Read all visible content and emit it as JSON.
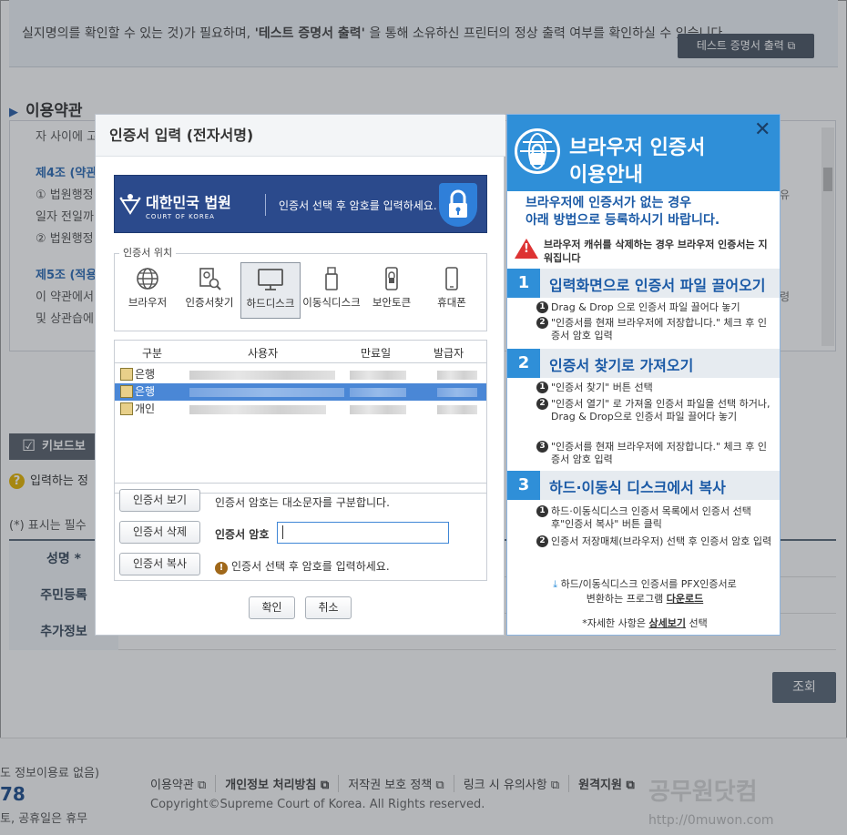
{
  "background": {
    "notice_line1": "실지명의를 확인할 수 있는 것)가 필요하며, ",
    "notice_bold": "'테스트 증명서 출력'",
    "notice_line1b": " 을 통해 소유하신 프린터의 정상 출력 여부를 확인하실 수 있습니다.",
    "test_print_button": "테스트 증명서 출력",
    "terms_title": "이용약관",
    "terms_lines": [
      "자 사이에 고",
      "제4조 (약관",
      "① 법원행정",
      "일자 전일까",
      "② 법원행정",
      "제5조 (적용",
      "이 약관에서",
      "및 상관습에"
    ],
    "terms_right_1": "유",
    "terms_right_2": "령",
    "keyboard_button": "키보드보",
    "help_text": "입력하는 정",
    "required_note": "(*) 표시는 필수",
    "form_labels": [
      "성명 *",
      "주민등록",
      "추가정보"
    ],
    "query_button": "조회",
    "footer_left1": "도 정보이용료 없음)",
    "footer_left2": "78",
    "footer_left3": "토, 공휴일은 휴무",
    "footer_links": [
      "이용약관",
      "개인정보 처리방침",
      "저작권 보호 정책",
      "링크 시 유의사항",
      "원격지원"
    ],
    "copyright": "Copyright©Supreme Court of Korea. All Rights reserved.",
    "watermark": "공무원닷컴",
    "watermark_url": "http://0muwon.com"
  },
  "dialog": {
    "title": "인증서 입력 (전자서명)",
    "banner_name": "대한민국 법원",
    "banner_sub": "COURT OF KOREA",
    "banner_msg": "인증서 선택 후 암호를 입력하세요.",
    "location_legend": "인증서 위치",
    "locations": [
      {
        "label": "브라우저",
        "icon": "globe-icon"
      },
      {
        "label": "인증서찾기",
        "icon": "cert-search-icon"
      },
      {
        "label": "하드디스크",
        "icon": "monitor-icon"
      },
      {
        "label": "이동식디스크",
        "icon": "usb-icon"
      },
      {
        "label": "보안토큰",
        "icon": "token-icon"
      },
      {
        "label": "휴대폰",
        "icon": "phone-icon"
      }
    ],
    "selected_location": "하드디스크",
    "table_headers": [
      "구분",
      "사용자",
      "만료일",
      "발급자"
    ],
    "rows": [
      {
        "type": "은행"
      },
      {
        "type": "은행"
      },
      {
        "type": "개인"
      }
    ],
    "view_button": "인증서 보기",
    "delete_button": "인증서 삭제",
    "copy_button": "인증서 복사",
    "case_note": "인증서 암호는 대소문자를 구분합니다.",
    "password_label": "인증서 암호",
    "password_value": "",
    "warning_msg": "인증서 선택 후 암호를 입력하세요.",
    "ok_button": "확인",
    "cancel_button": "취소"
  },
  "guide": {
    "title1": "브라우저 인증서",
    "title2": "이용안내",
    "intro1": "브라우저에 인증서가 없는 경우",
    "intro2": "아래 방법으로 등록하시기 바랍니다.",
    "warning": "브라우저 캐쉬를 삭제하는 경우 브라우저 인증서는 지워집니다",
    "sections": [
      {
        "num": "1",
        "title": "입력화면으로 인증서 파일 끌어오기"
      },
      {
        "num": "2",
        "title": "인증서 찾기로 가져오기"
      },
      {
        "num": "3",
        "title": "하드·이동식 디스크에서 복사"
      }
    ],
    "s1_steps": [
      "Drag & Drop 으로 인증서 파일 끌어다 놓기",
      "\"인증서를 현재 브라우저에 저장합니다.\" 체크 후 인증서 암호 입력"
    ],
    "s2_steps": [
      "\"인증서 찾기\" 버튼 선택",
      "\"인증서 열기\" 로 가져올 인증서 파일을 선택 하거나, Drag & Drop으로 인증서 파일 끌어다 놓기",
      "\"인증서를 현재 브라우저에 저장합니다.\" 체크 후 인증서 암호 입력"
    ],
    "s3_steps": [
      "하드·이동식디스크 인증서 목록에서 인증서 선택 후\"인증서 복사\" 버튼 클릭",
      "인증서 저장매체(브라우저) 선택 후 인증서 암호 입력"
    ],
    "pfx_line1": "하드/이동식디스크 인증서를 PFX인증서로",
    "pfx_line2": "변환하는 프로그램",
    "pfx_link": "다운로드",
    "detail_pre": "*자세한 사항은",
    "detail_link": "상세보기",
    "detail_post": "선택"
  },
  "colors": {
    "accent": "#2f8fd8",
    "banner": "#2b4a8c",
    "selected_row": "#4a87d6"
  }
}
